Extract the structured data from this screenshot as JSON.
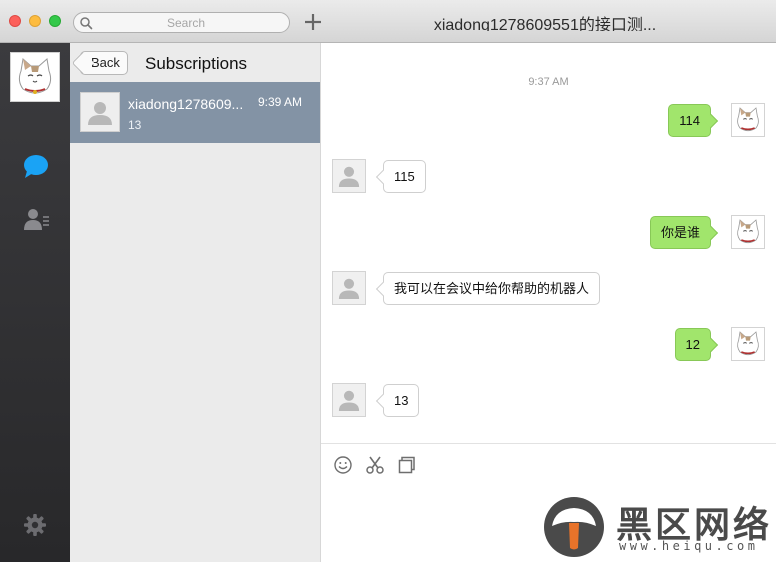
{
  "window": {
    "title": "xiadong1278609551的接口测..."
  },
  "search": {
    "placeholder": "Search"
  },
  "subscriptions": {
    "back_label": "Back",
    "title": "Subscriptions",
    "items": [
      {
        "name": "xiadong1278609...",
        "time": "9:39 AM",
        "preview": "13"
      }
    ]
  },
  "chat": {
    "timestamp": "9:37 AM",
    "messages": [
      {
        "direction": "out",
        "text": "114"
      },
      {
        "direction": "in",
        "text": "115"
      },
      {
        "direction": "out",
        "text": "你是谁"
      },
      {
        "direction": "in",
        "text": "我可以在会议中给你帮助的机器人"
      },
      {
        "direction": "out",
        "text": "12"
      },
      {
        "direction": "in",
        "text": "13"
      }
    ]
  },
  "icons": {
    "search": "search-icon",
    "plus": "plus-icon",
    "chat": "chat-bubble-icon",
    "contacts": "contacts-icon",
    "settings": "gear-icon",
    "emoji": "smiley-icon",
    "screenshot": "scissors-icon",
    "files": "files-icon"
  },
  "colors": {
    "sent_bubble": "#a1e56c",
    "selected_row": "#8393a5",
    "sidebar": "#333336",
    "chat_icon_active": "#1aa3f5"
  },
  "watermark": {
    "text": "黑区网络",
    "url": "www.heiqu.com"
  }
}
